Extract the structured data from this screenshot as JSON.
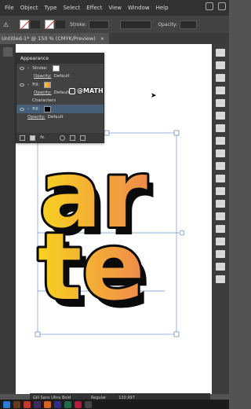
{
  "menu": {
    "items": [
      "File",
      "Object",
      "Type",
      "Select",
      "Effect",
      "View",
      "Window",
      "Help"
    ]
  },
  "control_bar": {
    "stroke_label": "Stroke:",
    "opacity_label": "Opacity:"
  },
  "document": {
    "tab_title": "Untitled-1* @ 150 % (CMYK/Preview)",
    "close_symbol": "×"
  },
  "appearance_panel": {
    "title": "Appearance",
    "rows": [
      {
        "label": "Stroke:",
        "opacity_label": "Opacity:",
        "opacity_value": "Default"
      },
      {
        "label": "Fill:",
        "opacity_label": "Opacity:",
        "opacity_value": "Default"
      }
    ],
    "characters_label": "Characters",
    "selected_fill_label": "Fill:",
    "bottom_opacity_label": "Opacity:",
    "bottom_opacity_value": "Default",
    "fx_label": "fx."
  },
  "watermark": {
    "handle": "@MATH"
  },
  "artwork": {
    "line1": "ar",
    "line2": "te",
    "gradient_start": "#f7d21f",
    "gradient_end": "#f08a4b",
    "shadow_color": "#0a0a0a"
  },
  "bottom_bar": {
    "font_name": "Gill Sans Ultra Bold",
    "style_value": "Regular",
    "size_value": "130.997"
  },
  "colors": {
    "menubar": "#323232",
    "panel": "#424242",
    "selection": "#46607a",
    "bounding_box": "#8aa4d6"
  }
}
